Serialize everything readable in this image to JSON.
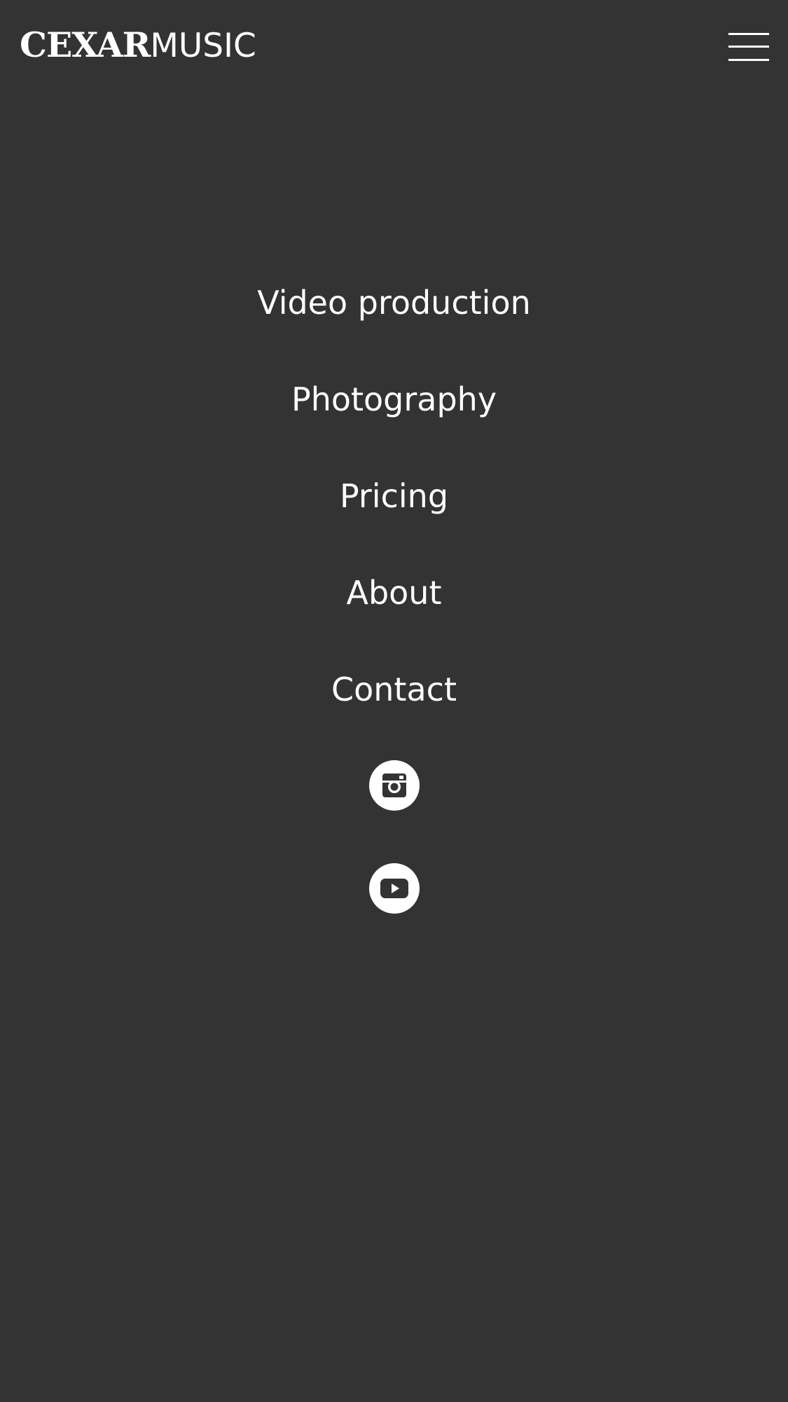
{
  "header": {
    "logo_strong": "CEXAR",
    "logo_light": "MUSIC",
    "menu_icon": "hamburger-menu-icon"
  },
  "nav": {
    "items": [
      {
        "label": "Video production"
      },
      {
        "label": "Photography"
      },
      {
        "label": "Pricing"
      },
      {
        "label": "About"
      },
      {
        "label": "Contact"
      }
    ]
  },
  "social": {
    "icons": [
      "instagram-icon",
      "youtube-icon"
    ]
  },
  "colors": {
    "background": "#333333",
    "foreground": "#ffffff"
  }
}
